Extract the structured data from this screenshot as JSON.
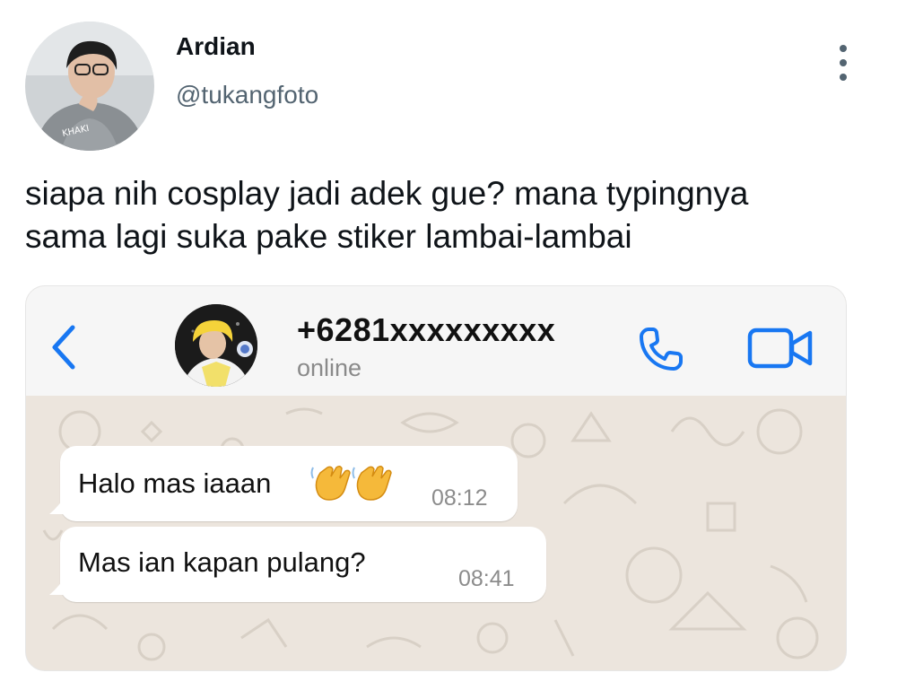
{
  "tweet": {
    "author_name": "Ardian",
    "author_handle": "@tukangfoto",
    "text": "siapa nih cosplay jadi adek gue? mana typingnya\nsama lagi suka pake stiker lambai-lambai",
    "more_icon": "more-vertical-icon"
  },
  "chat": {
    "contact_name": "+6281xxxxxxxxx",
    "status": "online",
    "icons": {
      "back": "chevron-left-icon",
      "call": "phone-icon",
      "video": "video-camera-icon",
      "emoji": "waving-hand-emoji"
    },
    "accent_color": "#1877f2",
    "messages": [
      {
        "text": "Halo mas iaaan",
        "emoji": "👋👋",
        "time": "08:12"
      },
      {
        "text": "Mas ian kapan pulang?",
        "time": "08:41"
      }
    ]
  }
}
